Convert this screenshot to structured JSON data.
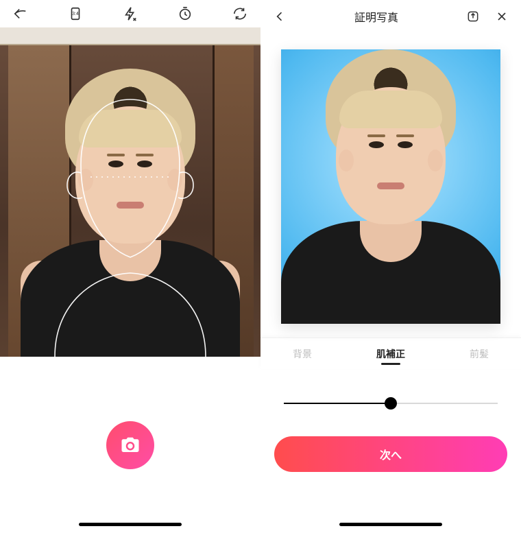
{
  "left": {
    "icons": {
      "back": "back-arrow-icon",
      "aspect": "aspect-3-4-icon",
      "aspect_label": "3:4",
      "flash": "flash-off-icon",
      "timer": "timer-icon",
      "flip": "camera-flip-icon"
    },
    "capture_label": "撮影"
  },
  "right": {
    "header": {
      "back": "chevron-left-icon",
      "title": "証明写真",
      "share": "share-icon",
      "close": "close-icon"
    },
    "tabs": [
      {
        "key": "background",
        "label": "背景",
        "active": false
      },
      {
        "key": "skin",
        "label": "肌補正",
        "active": true
      },
      {
        "key": "bangs",
        "label": "前髪",
        "active": false
      }
    ],
    "slider": {
      "min": 0,
      "max": 100,
      "value": 50
    },
    "next_label": "次へ"
  }
}
